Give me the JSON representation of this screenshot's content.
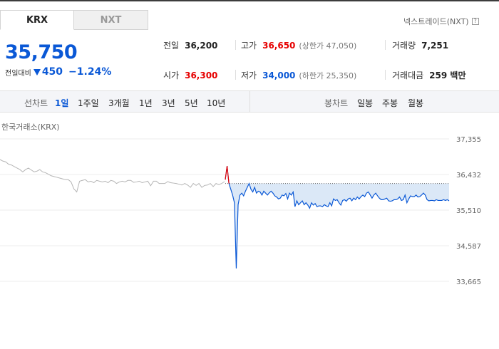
{
  "tabs": [
    {
      "label": "KRX",
      "active": true
    },
    {
      "label": "NXT",
      "active": false
    }
  ],
  "nxt_link": {
    "label": "넥스트레이드(NXT)",
    "help": "?"
  },
  "price": "35,750",
  "change": {
    "label": "전일대비",
    "direction": "down",
    "value": "450",
    "percent": "−1.24%"
  },
  "stats": {
    "prev_close": {
      "label": "전일",
      "value": "36,200"
    },
    "high": {
      "label": "고가",
      "value": "36,650",
      "sub": "(상한가 47,050)"
    },
    "volume": {
      "label": "거래량",
      "value": "7,251"
    },
    "open": {
      "label": "시가",
      "value": "36,300"
    },
    "low": {
      "label": "저가",
      "value": "34,000",
      "sub": "(하한가 25,350)"
    },
    "trade_value": {
      "label": "거래대금",
      "value": "259 백만"
    }
  },
  "period_bar": {
    "line_label": "선차트",
    "periods": [
      "1일",
      "1주일",
      "3개월",
      "1년",
      "3년",
      "5년",
      "10년"
    ],
    "selected": "1일",
    "candle_label": "봉차트",
    "candles": [
      "일봉",
      "주봉",
      "월봉"
    ]
  },
  "chart_source": "한국거래소(KRX)",
  "colors": {
    "accent_blue": "#0a58d6",
    "up_red": "#e60000",
    "prev_gray": "#b5b5b5",
    "fill_blue": "#dbe8f7"
  },
  "chart_data": {
    "type": "line",
    "ylim": [
      33665,
      37355
    ],
    "y_ticks": [
      "37,355",
      "36,432",
      "35,510",
      "34,587",
      "33,665"
    ],
    "y_tick_values": [
      37355,
      36432,
      35510,
      34587,
      33665
    ],
    "reference_line": 36200,
    "series": [
      {
        "role": "previous-day",
        "values": [
          36820,
          36780,
          36760,
          36700,
          36680,
          36640,
          36600,
          36560,
          36500,
          36560,
          36600,
          36550,
          36500,
          36520,
          36560,
          36500,
          36480,
          36440,
          36400,
          36380,
          36360,
          36340,
          36320,
          36300,
          36300,
          36240,
          36060,
          35980,
          36260,
          36280,
          36300,
          36240,
          36260,
          36220,
          36280,
          36260,
          36240,
          36260,
          36220,
          36280,
          36260,
          36200,
          36240,
          36260,
          36240,
          36280,
          36280,
          36230,
          36240,
          36260,
          36220,
          36240,
          36260,
          36140,
          36260,
          36260,
          36200,
          36200,
          36200,
          36250,
          36220,
          36210,
          36200,
          36180,
          36160,
          36200,
          36160,
          36100,
          36200,
          36150,
          36200,
          36100,
          36150,
          36160,
          36200,
          36120,
          36200,
          36170,
          36200,
          36250
        ]
      },
      {
        "role": "today",
        "values": [
          36300,
          36650,
          36200,
          36050,
          35900,
          35700,
          34000,
          35650,
          35900,
          35950,
          35880,
          36000,
          36100,
          36200,
          36050,
          35980,
          36100,
          35950,
          36000,
          35980,
          35900,
          36000,
          35950,
          35900,
          35960,
          36000,
          35950,
          35880,
          35850,
          35800,
          35820,
          35900,
          35880,
          35940,
          35800,
          35950,
          35900,
          35980,
          35600,
          35750,
          35650,
          35700,
          35750,
          35650,
          35700,
          35640,
          35560,
          35700,
          35640,
          35680,
          35600,
          35620,
          35620,
          35600,
          35650,
          35620,
          35600,
          35700,
          35620,
          35800,
          35760,
          35780,
          35700,
          35640,
          35760,
          35780,
          35740,
          35800,
          35820,
          35750,
          35820,
          35780,
          35850,
          35800,
          35860,
          35900,
          35860,
          35950,
          35980,
          35900,
          35820,
          35900,
          35950,
          35880,
          35820,
          35780,
          35780,
          35800,
          35820,
          35750,
          35740,
          35750,
          35780,
          35780,
          35800,
          35850,
          35760,
          35780,
          35900,
          35700,
          35800,
          35880,
          35860,
          35860,
          35900,
          35850,
          35860,
          35900,
          35950,
          35900,
          35780,
          35750,
          35760,
          35760,
          35750,
          35780,
          35760,
          35760,
          35760,
          35780,
          35760,
          35780,
          35750
        ]
      }
    ]
  }
}
